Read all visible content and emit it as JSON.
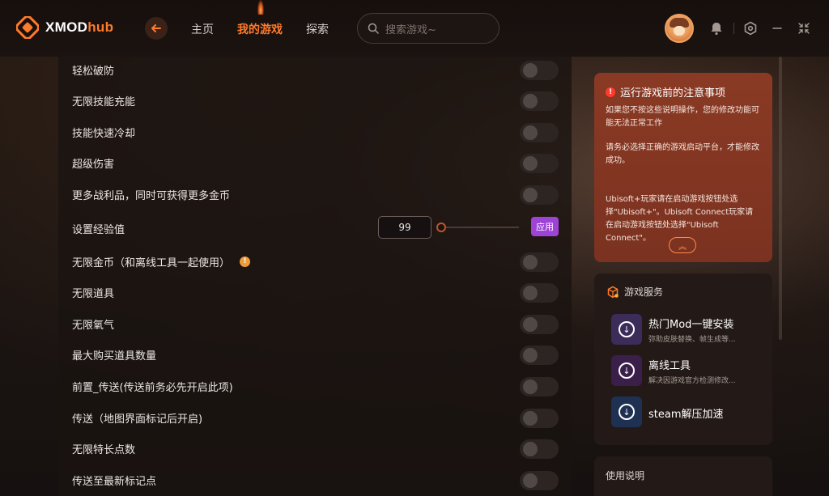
{
  "app": {
    "logo_prefix": "XMOD",
    "logo_suffix": "hub"
  },
  "nav": {
    "home": "主页",
    "my_games": "我的游戏",
    "explore": "探索"
  },
  "search": {
    "placeholder": "搜索游戏~"
  },
  "options": [
    {
      "label": "轻松破防",
      "type": "toggle",
      "on": false
    },
    {
      "label": "无限技能充能",
      "type": "toggle",
      "on": false
    },
    {
      "label": "技能快速冷却",
      "type": "toggle",
      "on": false
    },
    {
      "label": "超级伤害",
      "type": "toggle",
      "on": false
    },
    {
      "label": "更多战利品，同时可获得更多金币",
      "type": "toggle",
      "on": false
    },
    {
      "label": "设置经验值",
      "type": "slider",
      "value": "99",
      "apply_label": "应用"
    },
    {
      "label": "无限金币（和离线工具一起使用）",
      "type": "toggle",
      "on": false,
      "info": "!"
    },
    {
      "label": "无限道具",
      "type": "toggle",
      "on": false
    },
    {
      "label": "无限氧气",
      "type": "toggle",
      "on": false
    },
    {
      "label": "最大购买道具数量",
      "type": "toggle",
      "on": false
    },
    {
      "label": "前置_传送(传送前务必先开启此项)",
      "type": "toggle",
      "on": false
    },
    {
      "label": "传送（地图界面标记后开启)",
      "type": "toggle",
      "on": false
    },
    {
      "label": "无限特长点数",
      "type": "toggle",
      "on": false
    },
    {
      "label": "传送至最新标记点",
      "type": "toggle",
      "on": false
    }
  ],
  "notice": {
    "warn_glyph": "!",
    "title": "运行游戏前的注意事项",
    "p1": "如果您不按这些说明操作，您的修改功能可能无法正常工作",
    "p2": "请务必选择正确的游戏启动平台，才能修改成功。",
    "p3": "Ubisoft+玩家请在启动游戏按钮处选择\"Ubisoft+\"。Ubisoft Connect玩家请在启动游戏按钮处选择\"Ubisoft Connect\"。",
    "collapse_glyph": "︽"
  },
  "services": {
    "title": "游戏服务",
    "items": [
      {
        "name": "热门Mod一键安装",
        "desc": "弥助皮肤替换、帧生成等...",
        "bg": "#3b2c5a"
      },
      {
        "name": "离线工具",
        "desc": "解决因游戏官方检测修改...",
        "bg": "#3a1f4a"
      },
      {
        "name": "steam解压加速",
        "desc": "",
        "bg": "#1f3152"
      }
    ],
    "download_glyph": "↓"
  },
  "usage": {
    "title": "使用说明"
  },
  "colors": {
    "accent": "#ff7a2a",
    "apply": "#9d43d6",
    "notice_bg": "#8a3a24"
  }
}
